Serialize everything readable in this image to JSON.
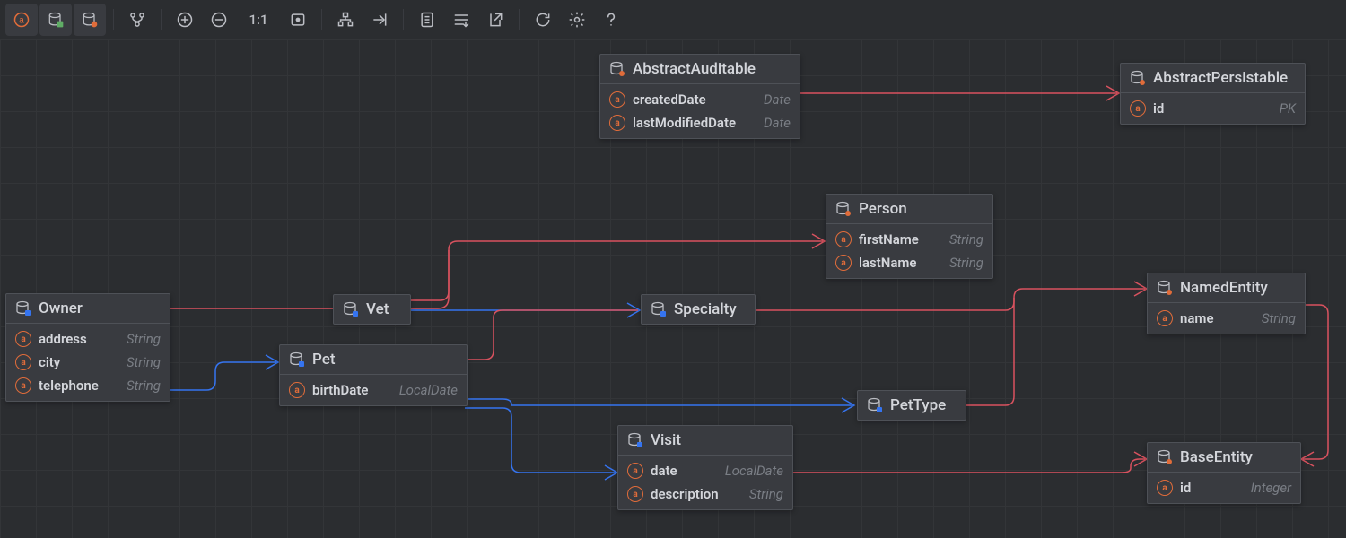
{
  "toolbar": {
    "zoom_label": "1:1"
  },
  "nodes": {
    "abstract_auditable": {
      "title": "AbstractAuditable",
      "attrs": [
        {
          "name": "createdDate",
          "type": "Date"
        },
        {
          "name": "lastModifiedDate",
          "type": "Date"
        }
      ]
    },
    "abstract_persistable": {
      "title": "AbstractPersistable",
      "attrs": [
        {
          "name": "id",
          "type": "PK"
        }
      ]
    },
    "owner": {
      "title": "Owner",
      "attrs": [
        {
          "name": "address",
          "type": "String"
        },
        {
          "name": "city",
          "type": "String"
        },
        {
          "name": "telephone",
          "type": "String"
        }
      ]
    },
    "vet": {
      "title": "Vet"
    },
    "specialty": {
      "title": "Specialty"
    },
    "person": {
      "title": "Person",
      "attrs": [
        {
          "name": "firstName",
          "type": "String"
        },
        {
          "name": "lastName",
          "type": "String"
        }
      ]
    },
    "named_entity": {
      "title": "NamedEntity",
      "attrs": [
        {
          "name": "name",
          "type": "String"
        }
      ]
    },
    "pet": {
      "title": "Pet",
      "attrs": [
        {
          "name": "birthDate",
          "type": "LocalDate"
        }
      ]
    },
    "pet_type": {
      "title": "PetType"
    },
    "visit": {
      "title": "Visit",
      "attrs": [
        {
          "name": "date",
          "type": "LocalDate"
        },
        {
          "name": "description",
          "type": "String"
        }
      ]
    },
    "base_entity": {
      "title": "BaseEntity",
      "attrs": [
        {
          "name": "id",
          "type": "Integer"
        }
      ]
    }
  }
}
